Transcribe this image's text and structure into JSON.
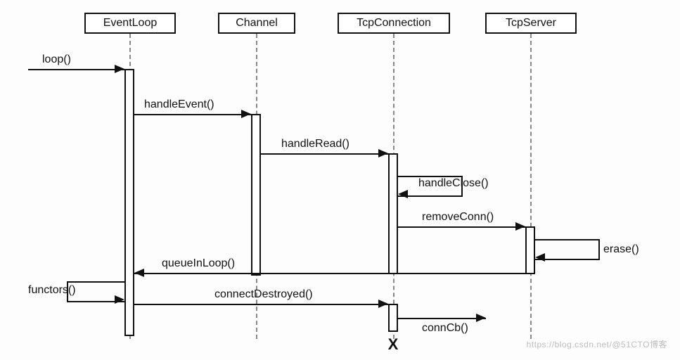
{
  "chart_data": {
    "type": "sequence-diagram",
    "participants": [
      "EventLoop",
      "Channel",
      "TcpConnection",
      "TcpServer"
    ],
    "messages": [
      {
        "from": "external",
        "to": "EventLoop",
        "label": "loop()",
        "kind": "call"
      },
      {
        "from": "EventLoop",
        "to": "Channel",
        "label": "handleEvent()",
        "kind": "call"
      },
      {
        "from": "Channel",
        "to": "TcpConnection",
        "label": "handleRead()",
        "kind": "call"
      },
      {
        "from": "TcpConnection",
        "to": "TcpConnection",
        "label": "handleClose()",
        "kind": "self"
      },
      {
        "from": "TcpConnection",
        "to": "TcpServer",
        "label": "removeConn()",
        "kind": "call"
      },
      {
        "from": "TcpServer",
        "to": "TcpServer",
        "label": "erase()",
        "kind": "self"
      },
      {
        "from": "TcpServer",
        "to": "EventLoop",
        "label": "queueInLoop()",
        "kind": "return"
      },
      {
        "from": "EventLoop",
        "to": "EventLoop",
        "label": "functors()",
        "kind": "self"
      },
      {
        "from": "EventLoop",
        "to": "TcpConnection",
        "label": "connectDestroyed()",
        "kind": "call"
      },
      {
        "from": "TcpConnection",
        "to": "external",
        "label": "connCb()",
        "kind": "call"
      }
    ],
    "terminations": [
      "TcpConnection"
    ]
  },
  "participants": {
    "p0": "EventLoop",
    "p1": "Channel",
    "p2": "TcpConnection",
    "p3": "TcpServer"
  },
  "labels": {
    "loop": "loop()",
    "handleEvent": "handleEvent()",
    "handleRead": "handleRead()",
    "handleClose": "handleClose()",
    "removeConn": "removeConn()",
    "erase": "erase()",
    "queueInLoop": "queueInLoop()",
    "functors": "functors()",
    "connectDestroyed": "connectDestroyed()",
    "connCb": "connCb()"
  },
  "watermark": "https://blog.csdn.net/@51CTO博客"
}
